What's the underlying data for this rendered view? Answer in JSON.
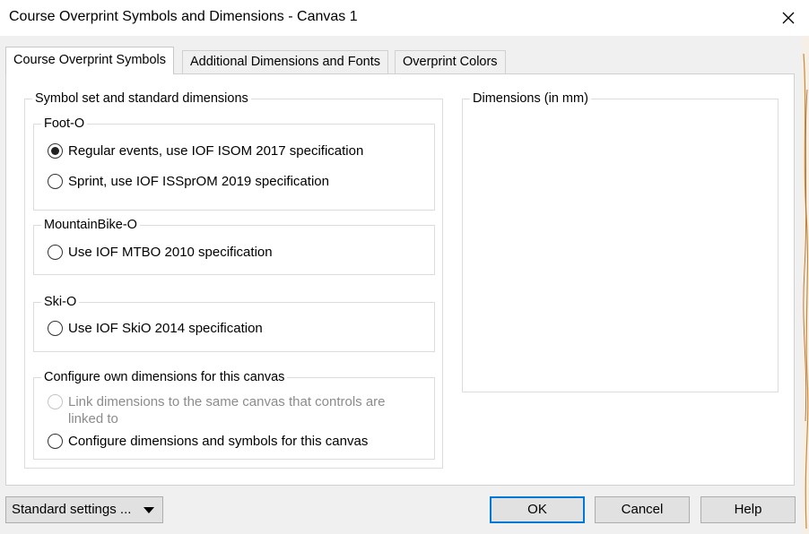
{
  "window": {
    "title": "Course Overprint Symbols and Dimensions - Canvas 1"
  },
  "tabs": [
    {
      "label": "Course Overprint Symbols",
      "active": true
    },
    {
      "label": "Additional Dimensions and Fonts",
      "active": false
    },
    {
      "label": "Overprint Colors",
      "active": false
    }
  ],
  "symbol_set": {
    "legend": "Symbol set and standard dimensions",
    "foot_o": {
      "legend": "Foot-O",
      "options": [
        {
          "label": "Regular events, use IOF ISOM 2017 specification",
          "checked": true
        },
        {
          "label": "Sprint, use IOF ISSprOM 2019 specification",
          "checked": false
        }
      ]
    },
    "mtbo": {
      "legend": "MountainBike-O",
      "options": [
        {
          "label": "Use IOF MTBO 2010 specification",
          "checked": false
        }
      ]
    },
    "ski_o": {
      "legend": "Ski-O",
      "options": [
        {
          "label": "Use IOF SkiO 2014 specification",
          "checked": false
        }
      ]
    },
    "own": {
      "legend": "Configure own dimensions for this canvas",
      "options": [
        {
          "label_line1": "Link dimensions to the same canvas that controls are",
          "label_line2": "linked to",
          "checked": false,
          "disabled": true
        },
        {
          "label": "Configure dimensions and symbols for this canvas",
          "checked": false
        }
      ]
    }
  },
  "dimensions": {
    "legend": "Dimensions (in mm)"
  },
  "footer": {
    "standard_settings_label": "Standard settings ...",
    "ok_label": "OK",
    "cancel_label": "Cancel",
    "help_label": "Help"
  },
  "colors": {
    "accent": "#0078d7",
    "panel_bg": "#ffffff",
    "dialog_bg": "#f0f0f0",
    "disabled_text": "#8c8c8c"
  }
}
